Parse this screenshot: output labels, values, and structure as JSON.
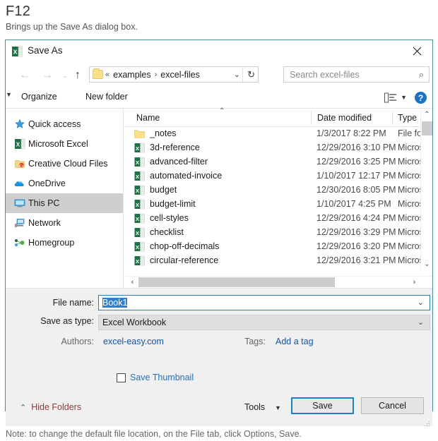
{
  "page": {
    "title": "F12",
    "subtitle": "Brings up the Save As dialog box.",
    "note": "Note: to change the default file location, on the File tab, click Options, Save."
  },
  "dialog": {
    "title": "Save As",
    "close_label": "✕"
  },
  "address_bar": {
    "back_icon": "←",
    "forward_icon": "→",
    "history_icon": "⌄",
    "up_icon": "↑",
    "chevrons": "«",
    "separator": "›",
    "crumbs": [
      "examples",
      "excel-files"
    ],
    "dropdown_caret": "⌄",
    "refresh_icon": "↻"
  },
  "search": {
    "placeholder": "Search excel-files",
    "icon": "⌕"
  },
  "toolbar": {
    "organize_label": "Organize",
    "organize_caret": "▼",
    "new_folder_label": "New folder",
    "view_caret": "▼",
    "help_label": "?"
  },
  "nav_pane": {
    "items": [
      {
        "label": "Quick access",
        "icon": "star-icon",
        "selected": false
      },
      {
        "label": "Microsoft Excel",
        "icon": "excel-icon",
        "selected": false
      },
      {
        "label": "Creative Cloud Files",
        "icon": "creative-cloud-icon",
        "selected": false
      },
      {
        "label": "OneDrive",
        "icon": "onedrive-icon",
        "selected": false
      },
      {
        "label": "This PC",
        "icon": "this-pc-icon",
        "selected": true
      },
      {
        "label": "Network",
        "icon": "network-icon",
        "selected": false
      },
      {
        "label": "Homegroup",
        "icon": "homegroup-icon",
        "selected": false
      }
    ]
  },
  "file_list": {
    "columns": [
      "Name",
      "Date modified",
      "Type"
    ],
    "sort_caret": "⌃",
    "rows": [
      {
        "name": "_notes",
        "date": "1/3/2017 8:22 PM",
        "type": "File fol",
        "icon": "folder-icon"
      },
      {
        "name": "3d-reference",
        "date": "12/29/2016 3:10 PM",
        "type": "Micros",
        "icon": "excel-file-icon"
      },
      {
        "name": "advanced-filter",
        "date": "12/29/2016 3:25 PM",
        "type": "Micros",
        "icon": "excel-file-icon"
      },
      {
        "name": "automated-invoice",
        "date": "1/10/2017 12:17 PM",
        "type": "Micros",
        "icon": "excel-file-icon"
      },
      {
        "name": "budget",
        "date": "12/30/2016 8:05 PM",
        "type": "Micros",
        "icon": "excel-file-icon"
      },
      {
        "name": "budget-limit",
        "date": "1/10/2017 4:25 PM",
        "type": "Micros",
        "icon": "excel-file-icon"
      },
      {
        "name": "cell-styles",
        "date": "12/29/2016 4:24 PM",
        "type": "Micros",
        "icon": "excel-file-icon"
      },
      {
        "name": "checklist",
        "date": "12/29/2016 3:29 PM",
        "type": "Micros",
        "icon": "excel-file-icon"
      },
      {
        "name": "chop-off-decimals",
        "date": "12/29/2016 3:20 PM",
        "type": "Micros",
        "icon": "excel-file-icon"
      },
      {
        "name": "circular-reference",
        "date": "12/29/2016 3:21 PM",
        "type": "Micros",
        "icon": "excel-file-icon"
      }
    ],
    "scroll": {
      "up_arrow": "⌃",
      "down_arrow": "⌄",
      "left_arrow": "‹",
      "right_arrow": "›"
    }
  },
  "form": {
    "file_name_label": "File name:",
    "file_name_value": "Book1",
    "save_as_type_label": "Save as type:",
    "save_as_type_value": "Excel Workbook",
    "authors_label": "Authors:",
    "authors_value": "excel-easy.com",
    "tags_label": "Tags:",
    "tags_value": "Add a tag",
    "caret": "⌄"
  },
  "footer": {
    "save_thumbnail_label": "Save Thumbnail",
    "hide_folders_label": "Hide Folders",
    "hide_folders_caret": "⌃",
    "tools_label": "Tools",
    "tools_caret": "▼",
    "save_label": "Save",
    "cancel_label": "Cancel"
  },
  "colors": {
    "dialog_border": "#4a8a9c",
    "accent_blue": "#1a82c4",
    "selection_blue": "#2f7fd1",
    "link_blue": "#1155a5",
    "excel_green": "#1e7145",
    "hide_folders_red": "#8a3a3a"
  }
}
